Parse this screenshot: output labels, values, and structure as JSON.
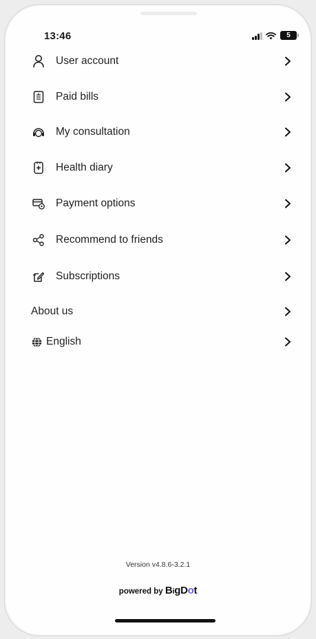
{
  "status_bar": {
    "time": "13:46",
    "battery": "5"
  },
  "menu": [
    {
      "label": "User account",
      "icon": "person-icon"
    },
    {
      "label": "Paid bills",
      "icon": "receipt-icon"
    },
    {
      "label": "My consultation",
      "icon": "headset-icon"
    },
    {
      "label": "Health diary",
      "icon": "diary-icon"
    },
    {
      "label": "Payment options",
      "icon": "card-icon"
    },
    {
      "label": "Recommend to friends",
      "icon": "share-icon"
    },
    {
      "label": "Subscriptions",
      "icon": "subscription-icon"
    },
    {
      "label": "About us",
      "icon": ""
    },
    {
      "label": "English",
      "icon": "globe-icon"
    }
  ],
  "footer": {
    "version": "Version v4.8.6-3.2.1",
    "powered_by": "powered by",
    "brand": "BigDot"
  }
}
